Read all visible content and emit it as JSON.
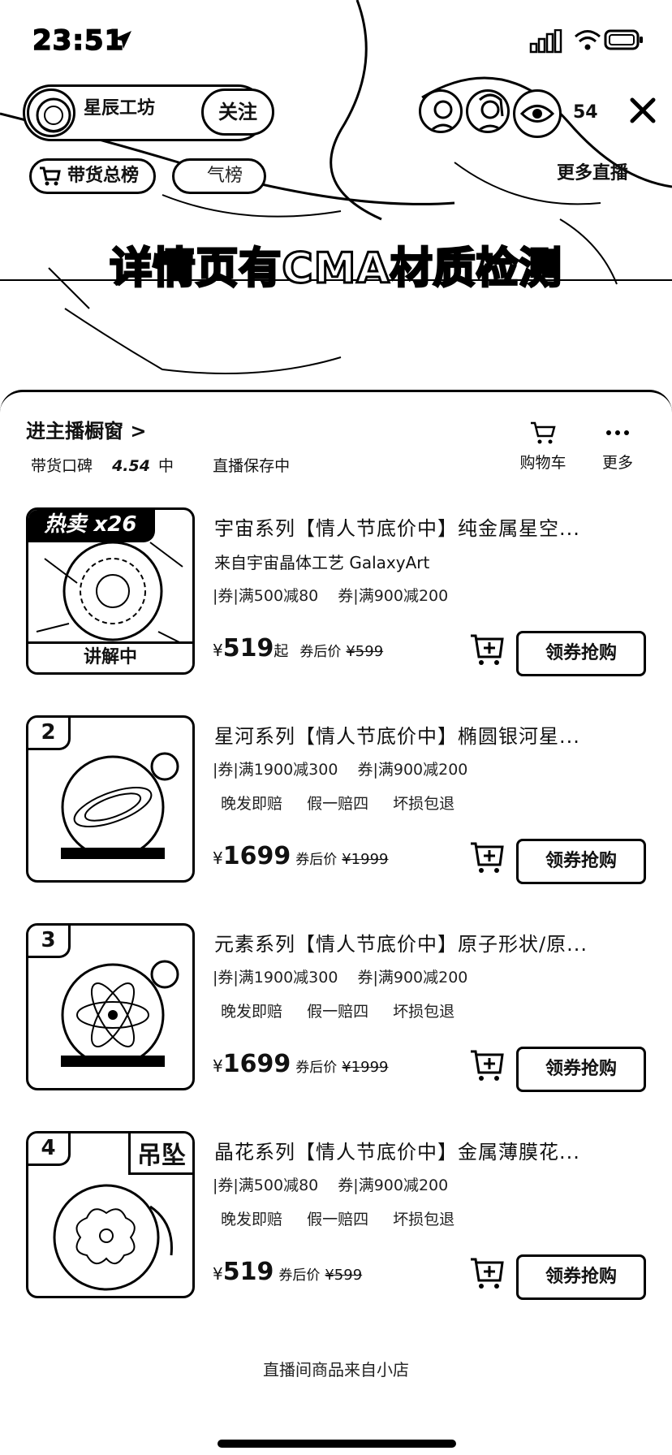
{
  "status": {
    "time": "23:51"
  },
  "host": {
    "name": "星辰工坊",
    "subtitle": "",
    "follow_label": "关注"
  },
  "viewers": {
    "count": "54"
  },
  "pills": {
    "rank": "带货总榜",
    "popularity": "气榜",
    "more_live": "更多直播"
  },
  "overlay": {
    "title": "详情页有CMA材质检测",
    "subtitle": "",
    "subtitle2": ""
  },
  "store": {
    "title": "进主播橱窗 >",
    "rating_label": "带货口碑",
    "rating_score": "4.54",
    "rating_level": "中",
    "save_label": "直播保存中",
    "cart_label": "购物车",
    "more_label": "更多"
  },
  "products": [
    {
      "rank": "热卖 x26",
      "explaining": "讲解中",
      "name": "宇宙系列【情人节底价中】纯金属星空...",
      "shop": "来自宇宙晶体工艺 GalaxyArt",
      "coupons": [
        "|券|满500减80",
        "券|满900减200"
      ],
      "guarantees": [],
      "price": "519",
      "price_suffix": "起",
      "after_label": "券后价",
      "old_price": "¥599",
      "buy_label": "领券抢购"
    },
    {
      "rank": "2",
      "name": "星河系列【情人节底价中】椭圆银河星...",
      "coupons": [
        "|券|满1900减300",
        "券|满900减200"
      ],
      "guarantees": [
        "晚发即赔",
        "假一赔四",
        "坏损包退"
      ],
      "price": "1699",
      "price_suffix": "",
      "after_label": "券后价",
      "old_price": "¥1999",
      "buy_label": "领券抢购"
    },
    {
      "rank": "3",
      "name": "元素系列【情人节底价中】原子形状/原...",
      "coupons": [
        "|券|满1900减300",
        "券|满900减200"
      ],
      "guarantees": [
        "晚发即赔",
        "假一赔四",
        "坏损包退"
      ],
      "price": "1699",
      "price_suffix": "",
      "after_label": "券后价",
      "old_price": "¥1999",
      "buy_label": "领券抢购"
    },
    {
      "rank": "4",
      "tag": "吊坠",
      "name": "晶花系列【情人节底价中】金属薄膜花...",
      "coupons": [
        "|券|满500减80",
        "券|满900减200"
      ],
      "guarantees": [
        "晚发即赔",
        "假一赔四",
        "坏损包退"
      ],
      "price": "519",
      "price_suffix": "",
      "after_label": "券后价",
      "old_price": "¥599",
      "buy_label": "领券抢购"
    }
  ],
  "currency": "¥",
  "footer": {
    "note": "直播间商品来自小店"
  },
  "icons": [
    "location-arrow-icon",
    "signal-icon",
    "wifi-icon",
    "battery-icon",
    "close-icon",
    "eye-icon",
    "cart-icon",
    "more-dots-icon",
    "add-to-cart-icon",
    "chevron-right-icon"
  ]
}
